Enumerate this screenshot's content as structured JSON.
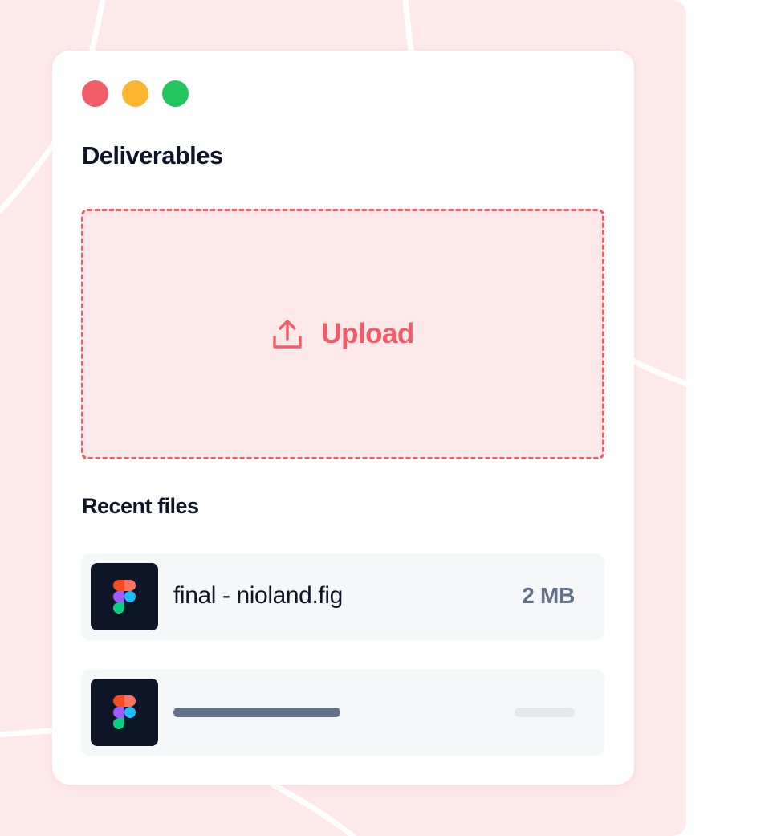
{
  "window": {
    "controls": [
      "close",
      "minimize",
      "maximize"
    ]
  },
  "deliverables": {
    "title": "Deliverables"
  },
  "upload": {
    "label": "Upload",
    "icon": "upload-icon"
  },
  "recent_files": {
    "title": "Recent files",
    "files": [
      {
        "name": "final - nioland.fig",
        "size": "2 MB",
        "icon": "figma-icon"
      },
      {
        "name": "",
        "size": "",
        "icon": "figma-icon",
        "loading": true
      }
    ]
  },
  "colors": {
    "accent": "#f25c69",
    "background": "#fde8ea",
    "text": "#0d1526",
    "muted": "#637089",
    "close": "#f25c69",
    "minimize": "#fbb52f",
    "maximize": "#22c55e"
  }
}
